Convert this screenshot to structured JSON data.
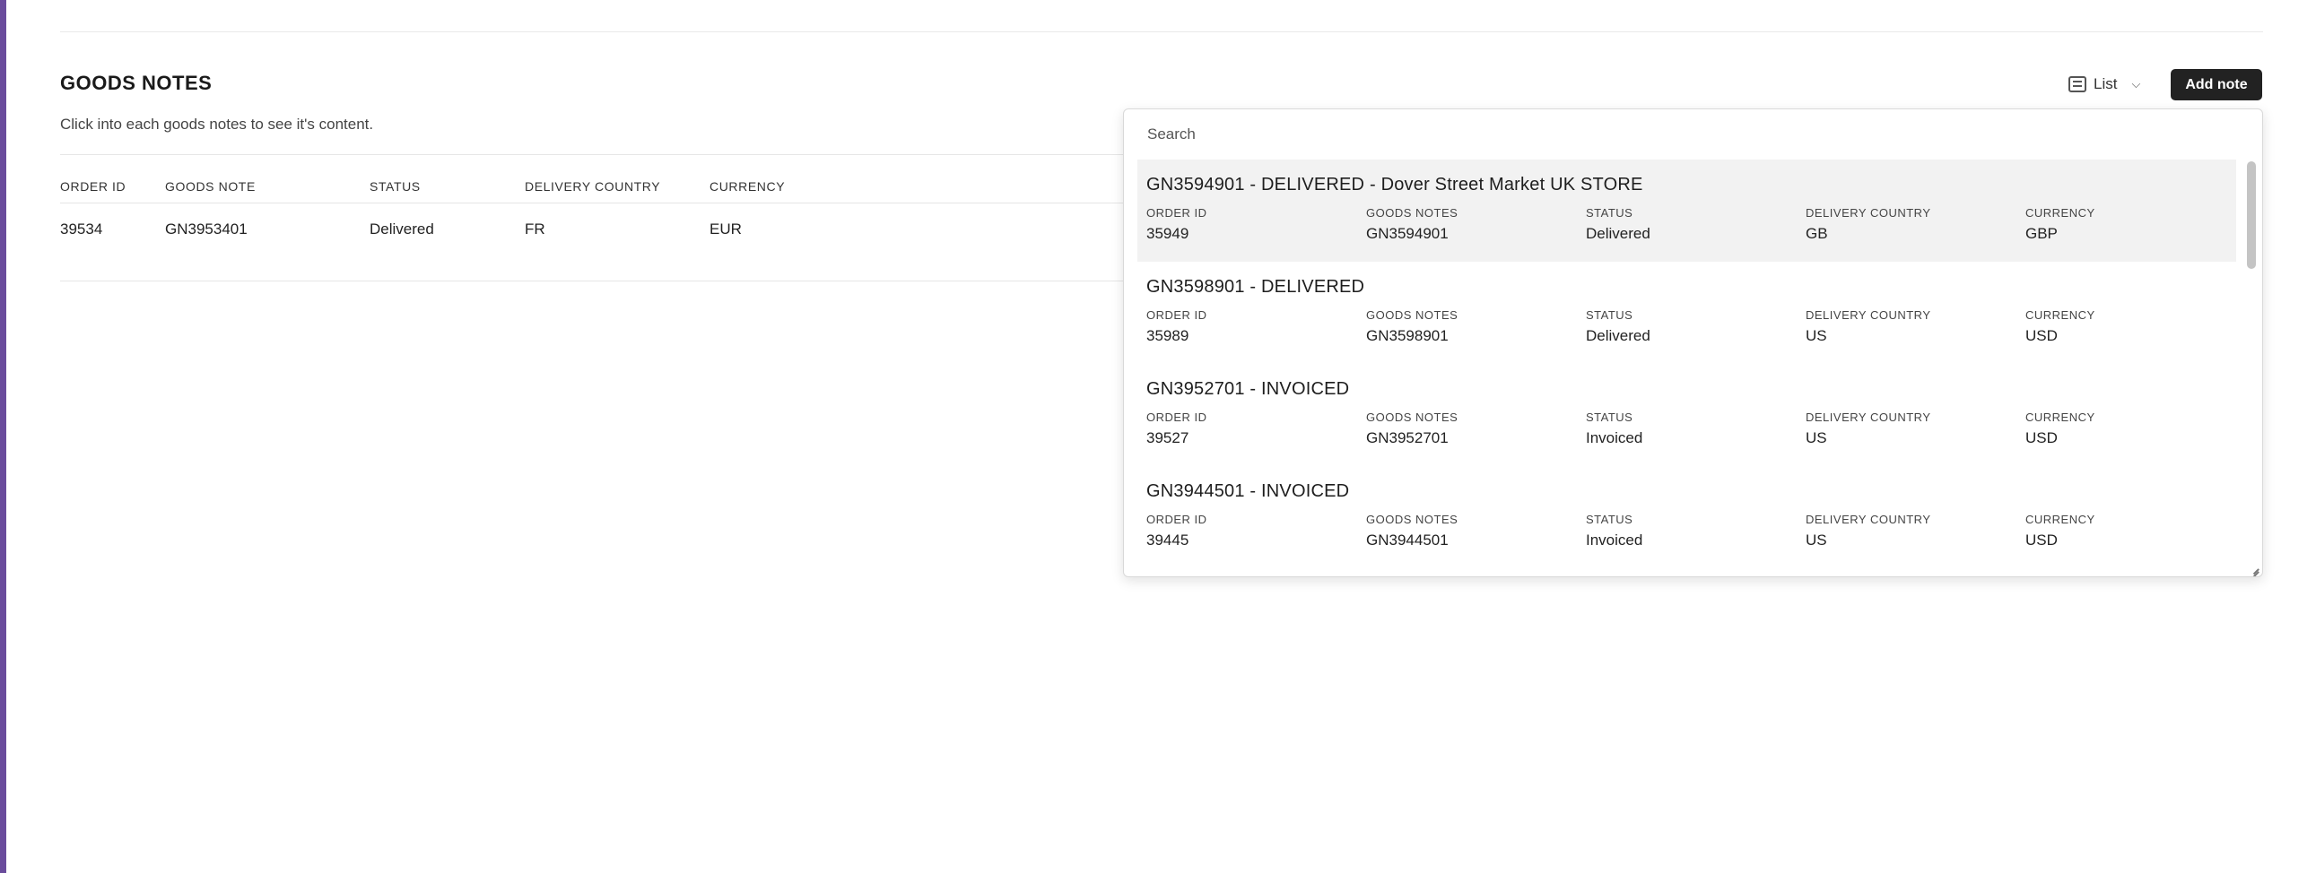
{
  "page": {
    "title": "GOODS NOTES",
    "subtitle": "Click into each goods notes to see it's content.",
    "accent_color": "#6a4c9c"
  },
  "toolbar": {
    "view_label": "List",
    "view_icon": "list-icon",
    "add_note_label": "Add note"
  },
  "table": {
    "headers": [
      "ORDER ID",
      "GOODS NOTE",
      "STATUS",
      "DELIVERY COUNTRY",
      "CURRENCY"
    ],
    "rows": [
      {
        "order_id": "39534",
        "goods_note": "GN3953401",
        "status": "Delivered",
        "delivery_country": "FR",
        "currency": "EUR"
      }
    ]
  },
  "dropdown": {
    "search_placeholder": "Search",
    "field_labels": {
      "order_id": "ORDER ID",
      "goods_notes": "GOODS NOTES",
      "status": "STATUS",
      "delivery_country": "DELIVERY COUNTRY",
      "currency": "CURRENCY"
    },
    "results": [
      {
        "title": "GN3594901 - DELIVERED - Dover Street Market UK STORE",
        "order_id": "35949",
        "goods_notes": "GN3594901",
        "status": "Delivered",
        "delivery_country": "GB",
        "currency": "GBP"
      },
      {
        "title": "GN3598901 - DELIVERED",
        "order_id": "35989",
        "goods_notes": "GN3598901",
        "status": "Delivered",
        "delivery_country": "US",
        "currency": "USD"
      },
      {
        "title": "GN3952701 - INVOICED",
        "order_id": "39527",
        "goods_notes": "GN3952701",
        "status": "Invoiced",
        "delivery_country": "US",
        "currency": "USD"
      },
      {
        "title": "GN3944501 - INVOICED",
        "order_id": "39445",
        "goods_notes": "GN3944501",
        "status": "Invoiced",
        "delivery_country": "US",
        "currency": "USD"
      }
    ]
  }
}
